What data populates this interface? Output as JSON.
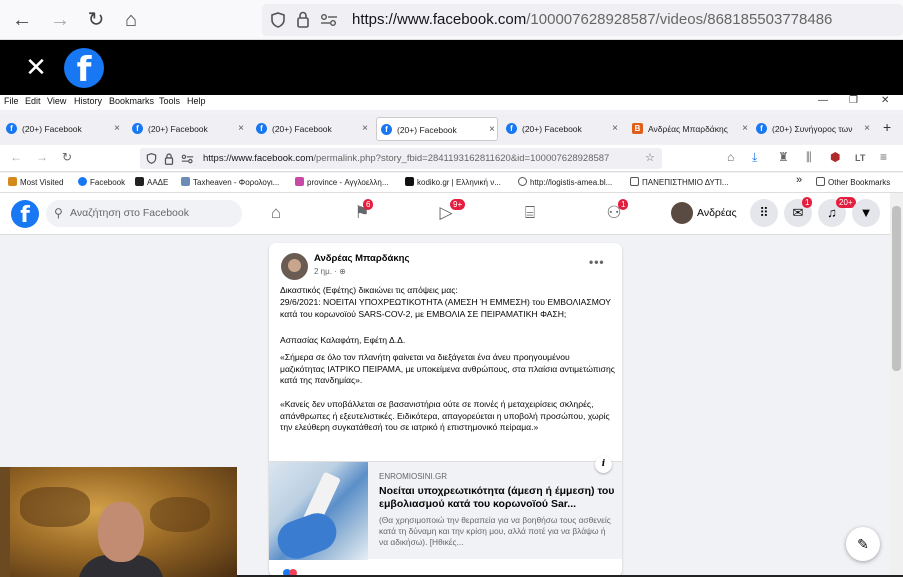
{
  "outer_browser": {
    "url_host": "https://www.facebook.com",
    "url_path": "/100007628928587/videos/868185503778486",
    "back": "←",
    "forward": "→",
    "reload": "↻",
    "home": "⌂"
  },
  "video_header": {
    "close": "✕",
    "logo": "f"
  },
  "inner_browser": {
    "menus": [
      "File",
      "Edit",
      "View",
      "History",
      "Bookmarks",
      "Tools",
      "Help"
    ],
    "menu_keys": [
      "F",
      "E",
      "V",
      "H",
      "B",
      "T",
      "H"
    ],
    "window_controls": {
      "minimize": "—",
      "restore": "❐",
      "close": "✕"
    },
    "tabs": [
      {
        "label": "(20+) Facebook"
      },
      {
        "label": "(20+) Facebook"
      },
      {
        "label": "(20+) Facebook"
      },
      {
        "label": "(20+) Facebook"
      },
      {
        "label": "(20+) Facebook"
      },
      {
        "label": "Ανδρέας Μπαρδάκης"
      },
      {
        "label": "(20+) Συνήγορος των"
      }
    ],
    "new_tab": "+",
    "tab_close": "×",
    "url_host": "https://www.facebook.com",
    "url_path": "/permalink.php?story_fbid=2841193162811620&id=100007628928587",
    "bookmarks": [
      "Most Visited",
      "Facebook",
      "ΑΑΔΕ",
      "Taxheaven - Φορολογι...",
      "province - Αγγλοελλη...",
      "kodiko.gr | Ελληνική ν...",
      "http://logistis-amea.bl...",
      "ΠΑΝΕΠΙΣΤΗΜΙΟ ΔΥΤΙ...",
      "Other Bookmarks"
    ],
    "bookmarks_overflow": "»"
  },
  "facebook": {
    "logo": "f",
    "search_placeholder": "Αναζήτηση στο Facebook",
    "badges": {
      "watch": "6",
      "video": "9+",
      "groups": "1",
      "messenger": "1",
      "notifications": "20+"
    },
    "user_name": "Ανδρέας",
    "post": {
      "author": "Ανδρέας Μπαρδάκης",
      "time": "2 ημ. · ",
      "menu": "•••",
      "p1": "Δικαστικός (Εφέτης) δικαιώνει τις απόψεις μας:",
      "p2": "29/6/2021: ΝΟΕΙΤΑΙ ΥΠΟΧΡΕΩΤΙΚΟΤΗΤΑ (ΑΜΕΣΗ Ή ΕΜΜΕΣΗ) του ΕΜΒΟΛΙΑΣΜΟΥ κατά του κορωνοϊού SARS-COV-2, με ΕΜΒΟΛΙΑ ΣΕ ΠΕΙΡΑΜΑΤΙΚΗ ΦΑΣΗ;",
      "p3": "Ασπασίας Καλαφάτη, Εφέτη Δ.Δ.",
      "p4": "«Σήμερα σε όλο τον πλανήτη φαίνεται να διεξάγεται ένα άνευ προηγουμένου μαζικότητας ΙΑΤΡΙΚΟ ΠΕΙΡΑΜΑ, με υποκείμενα ανθρώπους, στα πλαίσια αντιμετώπισης κατά της πανδημίας».",
      "p5": "«Κανείς δεν υποβάλλεται σε βασανιστήρια ούτε σε ποινές ή μεταχειρίσεις σκληρές, απάνθρωπες ή εξευτελιστικές. Ειδικότερα, απαγορεύεται η υποβολή προσώπου, χωρίς την ελεύθερη συγκατάθεσή του σε ιατρικό ή επιστημονικό πείραμα.»",
      "link": {
        "info": "i",
        "domain": "ENROMIOSINI.GR",
        "title": "Νοείται υποχρεωτικότητα (άμεση ή έμμεση) του εμβολιασμού κατά του κορωνοϊού Sar...",
        "desc": "(Θα χρησιμοποιώ την θεραπεία για να βοηθήσω τους ασθενείς κατά τη δύναμη και την κρίση μου, αλλά ποτέ για να βλάψω ή να αδικήσω). [Ηθικές..."
      }
    },
    "edit_icon": "✎"
  }
}
